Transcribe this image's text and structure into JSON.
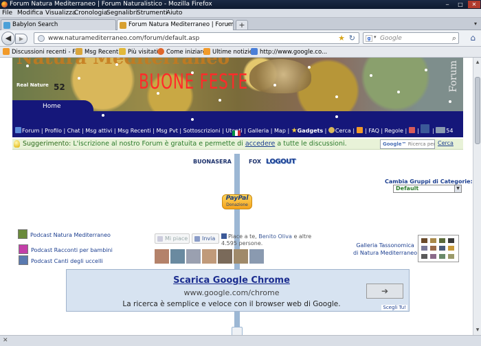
{
  "window": {
    "title": "Forum Natura Mediterraneo | Forum Naturalistico - Mozilla Firefox"
  },
  "menu": [
    "File",
    "Modifica",
    "Visualizza",
    "Cronologia",
    "Segnalibri",
    "Strumenti",
    "Aiuto"
  ],
  "tabs": [
    {
      "label": "Babylon Search",
      "active": false
    },
    {
      "label": "Forum Natura Mediterraneo | Forum ...",
      "active": true
    }
  ],
  "navigation": {
    "url": "www.naturamediterraneo.com/forum/default.asp",
    "search_placeholder": "Google"
  },
  "bookmarks": [
    {
      "label": "Discussioni recenti - F...",
      "icon": "rss-icon",
      "color": "#f19a2a"
    },
    {
      "label": "Msg Recenti",
      "icon": "pencil-icon",
      "color": "#d9a53c"
    },
    {
      "label": "Più visitati",
      "icon": "star-icon",
      "color": "#e2b93b"
    },
    {
      "label": "Come iniziare",
      "icon": "firefox-icon",
      "color": "#e0662a"
    },
    {
      "label": "Ultime notizie",
      "icon": "rss-icon",
      "color": "#f19a2a"
    },
    {
      "label": "http://www.google.co...",
      "icon": "google-icon",
      "color": "#4a7fd8"
    }
  ],
  "banner": {
    "site_title": "Natura Mediterraneo",
    "greeting": "BUONE FESTE",
    "side_label": "Forum",
    "logo_text": "Real Nature",
    "logo_number": "52"
  },
  "home_tab": "Home",
  "nav_links": [
    "Forum",
    "Profilo",
    "Chat",
    "Msg attivi",
    "Msg Recenti",
    "Msg Pvt",
    "Sottoscrizioni",
    "Utenti",
    "Galleria",
    "Map",
    "Gadgets",
    "Cerca",
    "",
    "FAQ",
    "Regole",
    "",
    "",
    "54"
  ],
  "suggestion": {
    "label": "Suggerimento:",
    "message_before": "L'iscrizione al nostro Forum è gratuita e permette di",
    "link": "accedere",
    "message_after": "a tutte le discussioni.",
    "search_placeholder": "Ricerca person",
    "search_brand": "Google™",
    "search_button": "Cerca"
  },
  "user_bar": {
    "greeting": "BUONASERA",
    "username": "FOX",
    "logout": "LOGOUT"
  },
  "categories": {
    "label": "Cambia Gruppi di Categorie:",
    "selected": "Default"
  },
  "paypal": {
    "brand": "PayPal",
    "caption": "Donazione"
  },
  "podcasts": [
    {
      "label": "Podcast Natura Mediterraneo",
      "color": "#6a8a3a"
    },
    {
      "label": "Podcast Racconti per bambini",
      "color": "#c33fa8"
    },
    {
      "label": "Podcast Canti degli uccelli",
      "color": "#5a7ab0"
    }
  ],
  "facebook": {
    "like_label": "Mi piace",
    "send_label": "Invia",
    "text_before": "Piace a te,",
    "friend": "Benito Oliva",
    "text_after": "e altre 4.595 persone.",
    "faces": [
      "#b4826a",
      "#6a8aa0",
      "#9aa0b0",
      "#c09a7a",
      "#7a6a5a",
      "#a08a6a",
      "#8a9ab0"
    ]
  },
  "gallery": {
    "line1": "Galleria Tassonomica",
    "line2": "di Natura Mediterraneo"
  },
  "ad": {
    "title": "Scarica Google Chrome",
    "url": "www.google.com/chrome",
    "description": "La ricerca è semplice e veloce con il browser web di Google.",
    "choice": "Scegli Tu!"
  },
  "colors": {
    "nav_blue": "#15177a",
    "accent_red": "#ff2a2a",
    "suggest_bg": "#e8f2d8",
    "ad_bg": "#d7e3f1"
  }
}
